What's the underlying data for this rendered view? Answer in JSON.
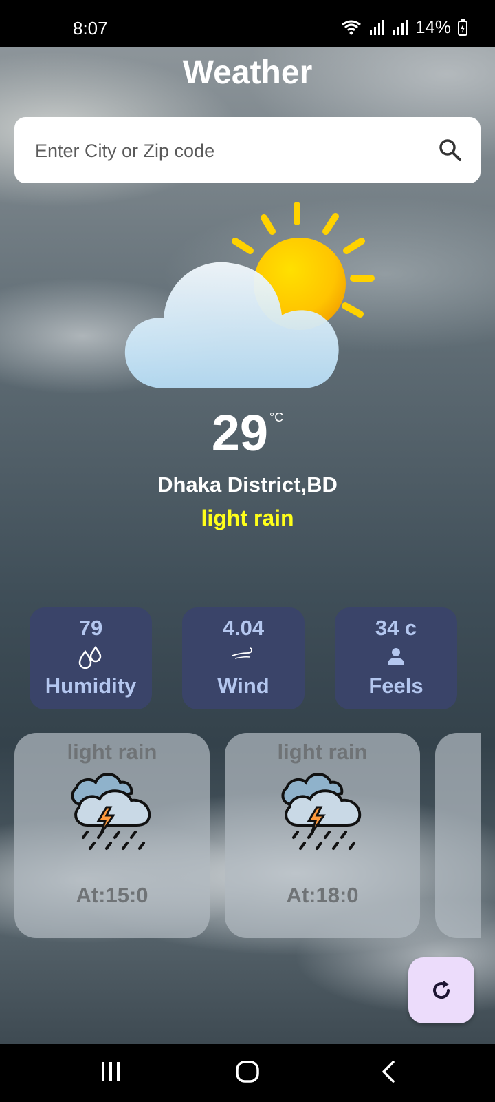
{
  "status_bar": {
    "time": "8:07",
    "battery": "14%"
  },
  "app": {
    "title": "Weather"
  },
  "search": {
    "placeholder": "Enter City or Zip code",
    "value": ""
  },
  "current": {
    "temperature": "29",
    "unit": "°C",
    "location": "Dhaka District,BD",
    "condition": "light rain",
    "icon": "partly-cloudy-sun-icon"
  },
  "stats": [
    {
      "value": "79",
      "label": "Humidity",
      "icon": "humidity-drops-icon"
    },
    {
      "value": "4.04",
      "label": "Wind",
      "icon": "wind-icon"
    },
    {
      "value": "34 c",
      "label": "Feels",
      "icon": "person-icon"
    }
  ],
  "forecast": [
    {
      "condition": "light rain",
      "time": "At:15:0",
      "icon": "thunderstorm-rain-icon"
    },
    {
      "condition": "light rain",
      "time": "At:18:0",
      "icon": "thunderstorm-rain-icon"
    }
  ],
  "colors": {
    "stat_card_bg": "#3a4469",
    "stat_text": "#b4c7ef",
    "condition_text": "#ffff1a",
    "fab_bg": "#ecdcfb"
  }
}
